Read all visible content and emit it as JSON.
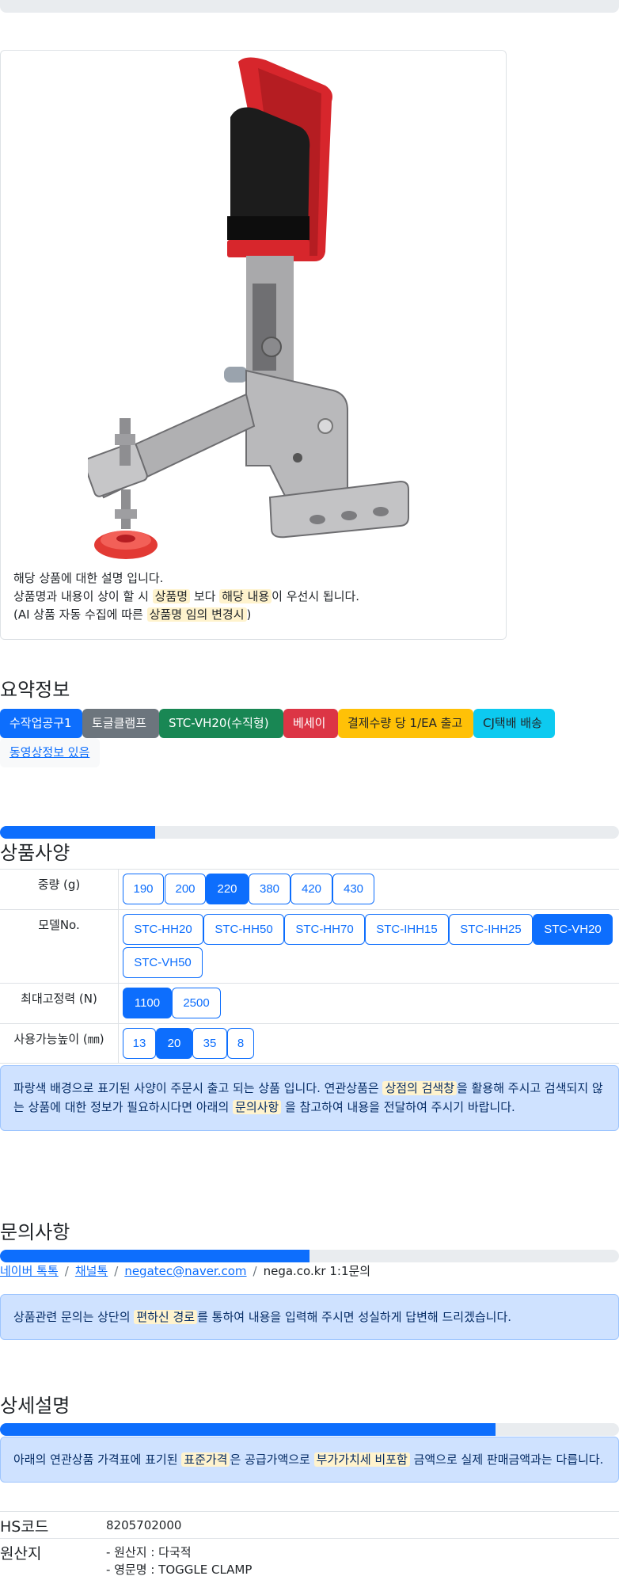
{
  "product": {
    "description_lines": [
      [
        "해당 상품에 대한 설명 입니다."
      ],
      [
        "상품명과 내용이 상이 할 시 ",
        "상품명",
        " 보다 ",
        "해당 내용",
        "이 우선시 됩니다."
      ],
      [
        "(AI 상품 자동 수집에 따른 ",
        "상품명 임의 변경시",
        ")"
      ]
    ]
  },
  "summary": {
    "title": "요약정보",
    "badges": [
      "수작업공구1",
      "토글클램프",
      "STC-VH20(수직형)",
      "베세이",
      "결제수량 당 1/EA 출고",
      "CJ택배 배송",
      "동영상정보 있음"
    ],
    "colors": {
      "primary": "#0d6efd",
      "secondary": "#6c757d",
      "success": "#198754",
      "danger": "#dc3545",
      "warning": "#ffc107",
      "info": "#0dcaf0"
    }
  },
  "specs": {
    "title": "상품사양",
    "progress": 0.25,
    "rows": [
      {
        "label": "중량 (g)",
        "options": [
          "190",
          "200",
          "220",
          "380",
          "420",
          "430"
        ],
        "selected": "220"
      },
      {
        "label": "모델No.",
        "options": [
          "STC-HH20",
          "STC-HH50",
          "STC-HH70",
          "STC-IHH15",
          "STC-IHH25",
          "STC-VH20",
          "STC-VH50"
        ],
        "selected": "STC-VH20"
      },
      {
        "label": "최대고정력 (N)",
        "options": [
          "1100",
          "2500"
        ],
        "selected": "1100"
      },
      {
        "label": "사용가능높이 (㎜)",
        "options": [
          "13",
          "20",
          "35",
          "8"
        ],
        "selected": "20"
      }
    ],
    "notice": [
      "파랑색 배경으로 표기된 사양이 주문시 출고 되는 상품 입니다. 연관상품은 ",
      "상점의 검색창",
      "을 활용해 주시고 검색되지 않는 상품에 대한 정보가 필요하시다면 아래의 ",
      "문의사항",
      " 을 참고하여 내용을 전달하여 주시기 바랍니다."
    ]
  },
  "inquiry": {
    "title": "문의사항",
    "progress": 0.5,
    "links": [
      "네이버 톡톡",
      "채널톡",
      "negatec@naver.com"
    ],
    "plain": "nega.co.kr 1:1문의",
    "notice": [
      "상품관련 문의는 상단의 ",
      "편하신 경로",
      "를 통하여 내용을 입력해 주시면 성실하게 답변해 드리겠습니다."
    ]
  },
  "detail": {
    "title": "상세설명",
    "progress": 0.8,
    "notice": [
      "아래의 연관상품 가격표에 표기된 ",
      "표준가격",
      "은 공급가액으로 ",
      "부가가치세 비포함",
      " 금액으로 실제 판매금액과는 다릅니다."
    ],
    "rows": [
      {
        "key": "HS코드",
        "values": [
          "8205702000"
        ]
      },
      {
        "key": "원산지",
        "values": [
          "- 원산지 : 다국적",
          "- 영문명 : TOGGLE CLAMP"
        ]
      }
    ]
  }
}
